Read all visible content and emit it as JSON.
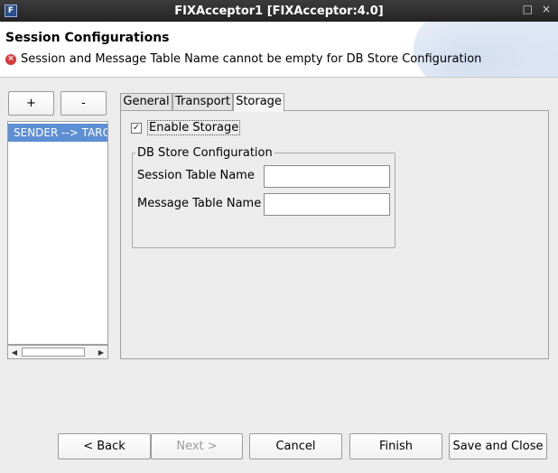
{
  "window": {
    "title": "FIXAcceptor1 [FIXAcceptor:4.0]",
    "app_icon": "f-icon",
    "minimize": "□",
    "close": "×"
  },
  "header": {
    "title": "Session Configurations",
    "error_message": "Session and Message Table Name cannot be empty for DB Store Configuration",
    "error_icon": "×"
  },
  "sessions": {
    "add_label": "+",
    "remove_label": "-",
    "items": [
      "SENDER --> TARGET"
    ],
    "scroll_left": "◀",
    "scroll_right": "▶"
  },
  "tabs": {
    "items": [
      "General",
      "Transport",
      "Storage"
    ],
    "active": "Storage"
  },
  "storage": {
    "enable_label": "Enable Storage",
    "enable_checked": true,
    "check_glyph": "✓",
    "group_title": "DB Store Configuration",
    "session_table_label": "Session Table Name",
    "session_table_value": "",
    "message_table_label": "Message Table Name",
    "message_table_value": ""
  },
  "footer": {
    "back": "< Back",
    "next": "Next >",
    "cancel": "Cancel",
    "finish": "Finish",
    "save_close": "Save and Close"
  },
  "colors": {
    "selection": "#5e8fd4",
    "error": "#d93a3a",
    "titlebar": "#2b2b2b"
  }
}
